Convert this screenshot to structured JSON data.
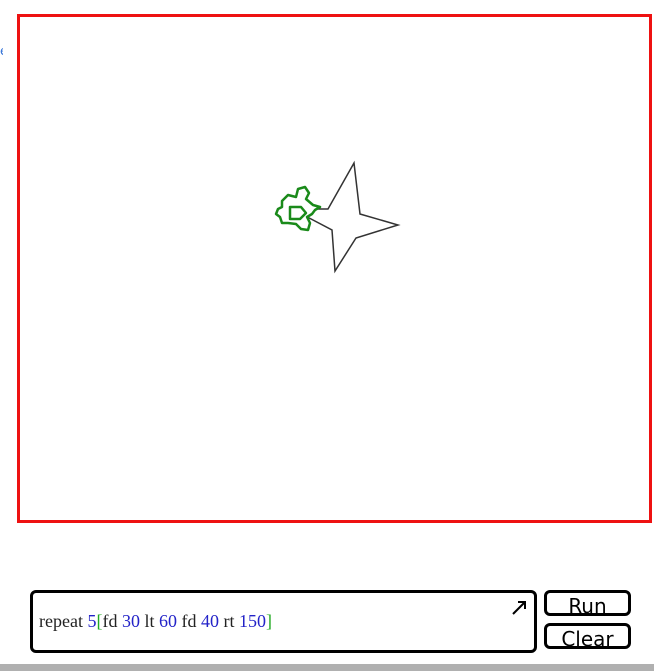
{
  "editor": {
    "tokens": [
      {
        "text": "repeat ",
        "kind": "kw"
      },
      {
        "text": "5",
        "kind": "num"
      },
      {
        "text": "[",
        "kind": "br"
      },
      {
        "text": "fd ",
        "kind": "kw"
      },
      {
        "text": "30",
        "kind": "num"
      },
      {
        "text": " lt ",
        "kind": "kw"
      },
      {
        "text": "60",
        "kind": "num"
      },
      {
        "text": " fd ",
        "kind": "kw"
      },
      {
        "text": "40",
        "kind": "num"
      },
      {
        "text": " rt ",
        "kind": "kw"
      },
      {
        "text": "150",
        "kind": "num"
      },
      {
        "text": "]",
        "kind": "br"
      }
    ],
    "expand_icon": "arrow-up-right-icon"
  },
  "buttons": {
    "run_label": "Run",
    "clear_label": "Clear"
  },
  "turtle": {
    "icon": "turtle-icon",
    "color": "#1a8a1a"
  },
  "colors": {
    "canvas_border": "#ee1111",
    "drawing_line": "#333333",
    "keyword": "#222222",
    "number": "#2323c8",
    "bracket": "#22aa22"
  }
}
